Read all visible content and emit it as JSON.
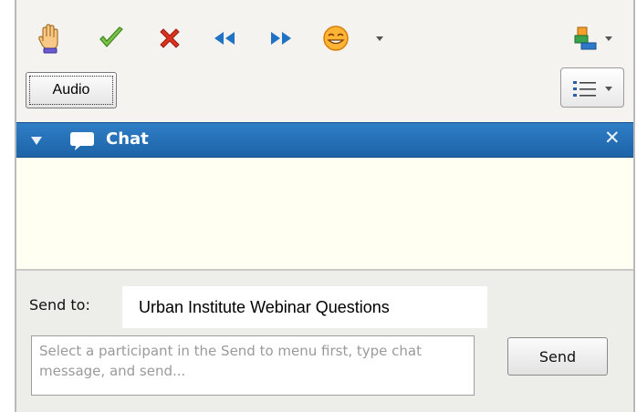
{
  "toolbar": {
    "icons": [
      "raise-hand-icon",
      "check-icon",
      "cross-icon",
      "rewind-icon",
      "fast-forward-icon",
      "emoticon-icon",
      "participants-icon",
      "list-icon"
    ],
    "audio_label": "Audio"
  },
  "chat": {
    "title": "Chat",
    "close_glyph": "✕",
    "send_to_label": "Send to:",
    "send_to_value": "Urban Institute Webinar Questions",
    "message_placeholder": "Select a participant in the Send to menu first, type chat message, and send...",
    "send_label": "Send"
  },
  "colors": {
    "header_blue": "#1f6ab3",
    "chat_background": "#fffff2",
    "panel_background": "#f0efec"
  }
}
